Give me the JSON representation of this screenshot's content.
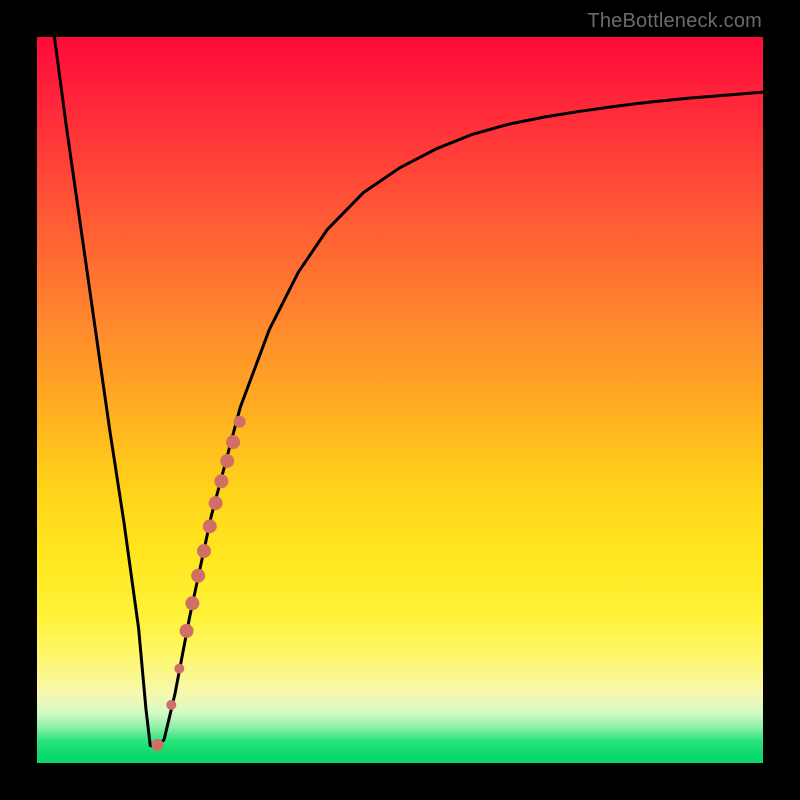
{
  "watermark": {
    "text": "TheBottleneck.com"
  },
  "chart_data": {
    "type": "line",
    "title": "",
    "xlabel": "",
    "ylabel": "",
    "xlim": [
      0,
      100
    ],
    "ylim": [
      0,
      100
    ],
    "grid": false,
    "series": [
      {
        "name": "curve",
        "x": [
          2.4,
          4.0,
          6.0,
          8.0,
          10.0,
          12.0,
          14.0,
          15.0,
          15.6,
          16.5,
          17.5,
          19.0,
          21.0,
          24.0,
          28.0,
          32.0,
          36.0,
          40.0,
          45.0,
          50.0,
          55.0,
          60.0,
          65.0,
          70.0,
          75.0,
          80.0,
          85.0,
          90.0,
          95.0,
          100.0
        ],
        "y": [
          100.0,
          88.0,
          74.0,
          60.0,
          46.0,
          33.0,
          18.5,
          7.5,
          2.4,
          2.3,
          3.2,
          9.5,
          20.0,
          34.0,
          49.0,
          59.7,
          67.6,
          73.5,
          78.6,
          82.0,
          84.6,
          86.6,
          88.0,
          89.0,
          89.8,
          90.5,
          91.1,
          91.6,
          92.0,
          92.4
        ]
      }
    ],
    "markers": [
      {
        "x": 16.6,
        "y": 2.5,
        "r": 6
      },
      {
        "x": 18.5,
        "y": 8.0,
        "r": 5
      },
      {
        "x": 19.6,
        "y": 13.0,
        "r": 5
      },
      {
        "x": 20.6,
        "y": 18.2,
        "r": 7
      },
      {
        "x": 21.4,
        "y": 22.0,
        "r": 7
      },
      {
        "x": 22.2,
        "y": 25.8,
        "r": 7
      },
      {
        "x": 23.0,
        "y": 29.2,
        "r": 7
      },
      {
        "x": 23.8,
        "y": 32.6,
        "r": 7
      },
      {
        "x": 24.6,
        "y": 35.8,
        "r": 7
      },
      {
        "x": 25.4,
        "y": 38.8,
        "r": 7
      },
      {
        "x": 26.2,
        "y": 41.6,
        "r": 7
      },
      {
        "x": 27.0,
        "y": 44.2,
        "r": 7
      },
      {
        "x": 27.9,
        "y": 47.0,
        "r": 6
      }
    ],
    "marker_color": "#cf6f66",
    "line_color": "#000000",
    "background_gradient": [
      {
        "stop": 0.0,
        "color": "#ff0a3a"
      },
      {
        "stop": 0.25,
        "color": "#ff5a35"
      },
      {
        "stop": 0.52,
        "color": "#ffb020"
      },
      {
        "stop": 0.8,
        "color": "#fff23a"
      },
      {
        "stop": 0.93,
        "color": "#d6fac6"
      },
      {
        "stop": 1.0,
        "color": "#0bd86b"
      }
    ]
  }
}
